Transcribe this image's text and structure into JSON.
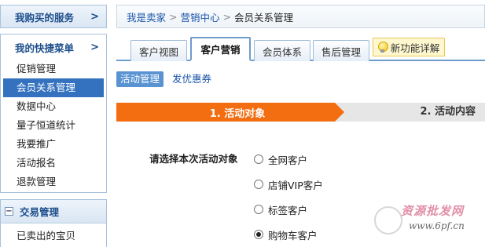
{
  "sidebar": {
    "purchase_box": {
      "title": "我购买的服务",
      "arrow": ">"
    },
    "quick_menu": {
      "title": "我的快捷菜单",
      "arrow": ">",
      "items": [
        {
          "label": "促销管理",
          "active": false
        },
        {
          "label": "会员关系管理",
          "active": true
        },
        {
          "label": "数据中心",
          "active": false
        },
        {
          "label": "量子恒道统计",
          "active": false
        },
        {
          "label": "我要推广",
          "active": false
        },
        {
          "label": "活动报名",
          "active": false
        },
        {
          "label": "退款管理",
          "active": false
        }
      ]
    },
    "trade_box": {
      "toggle": "−",
      "title": "交易管理",
      "items": [
        {
          "label": "已卖出的宝贝"
        }
      ]
    }
  },
  "breadcrumb": {
    "items": [
      "我是卖家",
      "营销中心",
      "会员关系管理"
    ],
    "separator": ">"
  },
  "tabs": [
    {
      "label": "客户视图",
      "active": false
    },
    {
      "label": "客户营销",
      "active": true
    },
    {
      "label": "会员体系",
      "active": false
    },
    {
      "label": "售后管理",
      "active": false
    }
  ],
  "feature_tab": {
    "label": "新功能详解",
    "icon": "lightbulb-icon"
  },
  "subtabs": [
    {
      "label": "活动管理",
      "active": true
    },
    {
      "label": "发优惠券",
      "active": false
    }
  ],
  "steps": {
    "step1": "1. 活动对象",
    "step2": "2. 活动内容"
  },
  "form": {
    "label": "请选择本次活动对象",
    "options": [
      {
        "label": "全网客户",
        "checked": false
      },
      {
        "label": "店铺VIP客户",
        "checked": false
      },
      {
        "label": "标签客户",
        "checked": false
      },
      {
        "label": "购物车客户",
        "checked": true
      }
    ]
  },
  "watermark": {
    "text": "资源批发网",
    "url": "www.6pf.cn"
  },
  "colors": {
    "accent_blue": "#3472c0",
    "step_orange": "#f26e11",
    "link_blue": "#1a55a8"
  }
}
